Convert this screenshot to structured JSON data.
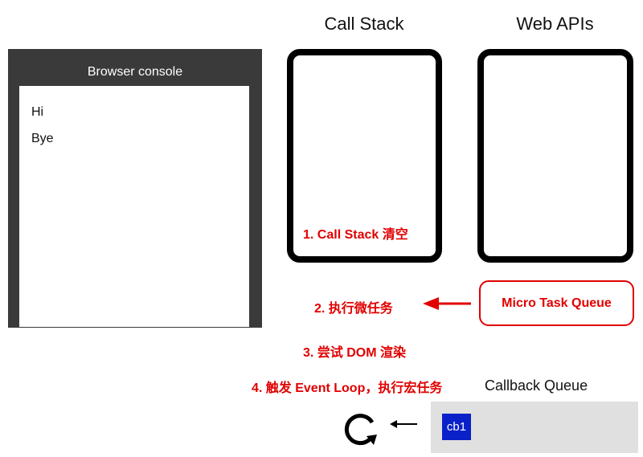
{
  "console": {
    "title": "Browser console",
    "lines": [
      "Hi",
      "Bye"
    ]
  },
  "call_stack": {
    "title": "Call Stack",
    "note": "1. Call Stack 清空"
  },
  "web_apis": {
    "title": "Web APIs"
  },
  "steps": {
    "step2": "2. 执行微任务",
    "step3": "3. 尝试 DOM 渲染",
    "step4": "4. 触发 Event Loop，执行宏任务"
  },
  "micro_task_queue": {
    "label": "Micro Task Queue"
  },
  "callback_queue": {
    "title": "Callback Queue",
    "items": [
      "cb1"
    ]
  },
  "icons": {
    "event_loop": "circular-arrow-icon",
    "arrow_to_steps": "arrow-left-icon",
    "arrow_to_loop": "arrow-left-icon"
  },
  "colors": {
    "accent_red": "#e10000",
    "console_bg": "#3a3a3a",
    "callback_item": "#0a20c8",
    "queue_bg": "#e0e0e0"
  }
}
